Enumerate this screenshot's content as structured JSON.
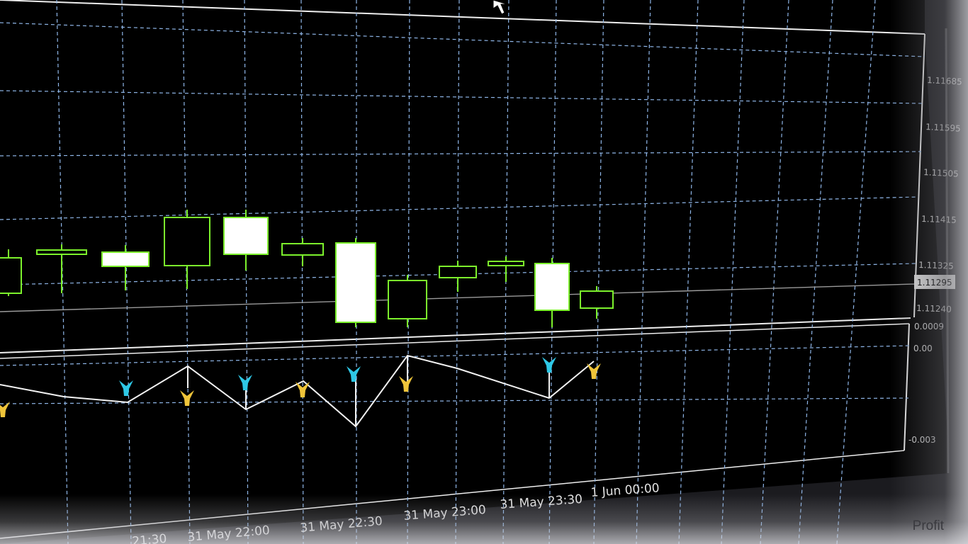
{
  "price_axis": {
    "labels": [
      "1.11685",
      "1.11595",
      "1.11505",
      "1.11415",
      "1.11325",
      "1.11240"
    ],
    "current_price": "1.11295"
  },
  "indicator_axis": {
    "labels": [
      "0.0009",
      "0.00",
      "-0.003"
    ]
  },
  "time_axis": {
    "labels": [
      "21:30",
      "31 May 22:00",
      "31 May 22:30",
      "31 May 23:00",
      "31 May 23:30",
      "1 Jun 00:00"
    ]
  },
  "bottom_panel": {
    "tab_label": "Profit"
  },
  "colors": {
    "background": "#000000",
    "grid": "#8fb6e8",
    "bull_candle": "#7cf12c",
    "bear_candle_fill": "#ffffff",
    "bid_line": "#9a9a9a",
    "axis_text": "#d8d8d8",
    "sell_arrow": "#2ec8e6",
    "buy_arrow": "#f0c53a",
    "zigzag": "#f2f2f2"
  },
  "icons": {
    "cursor": "mouse-pointer-icon",
    "sell_arrow": "sell-arrow-icon",
    "buy_arrow": "buy-arrow-icon"
  }
}
